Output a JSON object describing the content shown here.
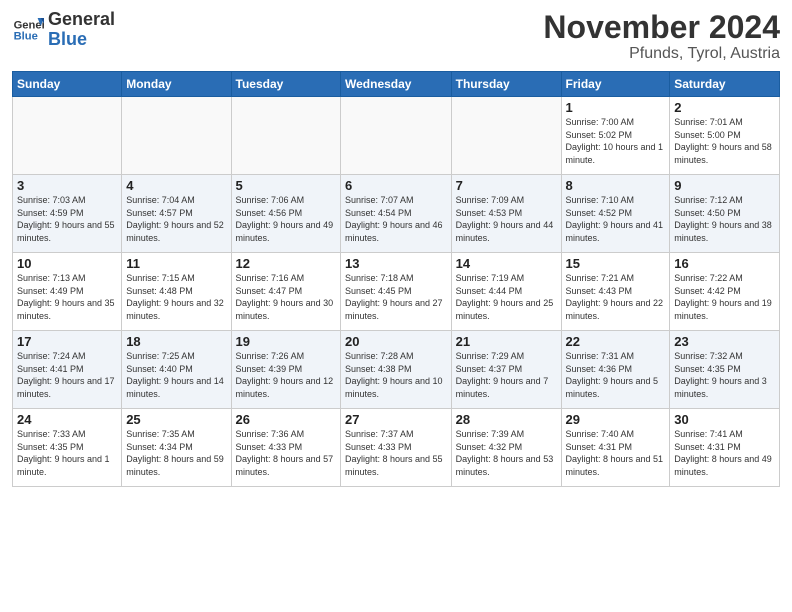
{
  "header": {
    "logo_line1": "General",
    "logo_line2": "Blue",
    "month": "November 2024",
    "location": "Pfunds, Tyrol, Austria"
  },
  "days_of_week": [
    "Sunday",
    "Monday",
    "Tuesday",
    "Wednesday",
    "Thursday",
    "Friday",
    "Saturday"
  ],
  "weeks": [
    [
      {
        "day": "",
        "info": ""
      },
      {
        "day": "",
        "info": ""
      },
      {
        "day": "",
        "info": ""
      },
      {
        "day": "",
        "info": ""
      },
      {
        "day": "",
        "info": ""
      },
      {
        "day": "1",
        "info": "Sunrise: 7:00 AM\nSunset: 5:02 PM\nDaylight: 10 hours and 1 minute."
      },
      {
        "day": "2",
        "info": "Sunrise: 7:01 AM\nSunset: 5:00 PM\nDaylight: 9 hours and 58 minutes."
      }
    ],
    [
      {
        "day": "3",
        "info": "Sunrise: 7:03 AM\nSunset: 4:59 PM\nDaylight: 9 hours and 55 minutes."
      },
      {
        "day": "4",
        "info": "Sunrise: 7:04 AM\nSunset: 4:57 PM\nDaylight: 9 hours and 52 minutes."
      },
      {
        "day": "5",
        "info": "Sunrise: 7:06 AM\nSunset: 4:56 PM\nDaylight: 9 hours and 49 minutes."
      },
      {
        "day": "6",
        "info": "Sunrise: 7:07 AM\nSunset: 4:54 PM\nDaylight: 9 hours and 46 minutes."
      },
      {
        "day": "7",
        "info": "Sunrise: 7:09 AM\nSunset: 4:53 PM\nDaylight: 9 hours and 44 minutes."
      },
      {
        "day": "8",
        "info": "Sunrise: 7:10 AM\nSunset: 4:52 PM\nDaylight: 9 hours and 41 minutes."
      },
      {
        "day": "9",
        "info": "Sunrise: 7:12 AM\nSunset: 4:50 PM\nDaylight: 9 hours and 38 minutes."
      }
    ],
    [
      {
        "day": "10",
        "info": "Sunrise: 7:13 AM\nSunset: 4:49 PM\nDaylight: 9 hours and 35 minutes."
      },
      {
        "day": "11",
        "info": "Sunrise: 7:15 AM\nSunset: 4:48 PM\nDaylight: 9 hours and 32 minutes."
      },
      {
        "day": "12",
        "info": "Sunrise: 7:16 AM\nSunset: 4:47 PM\nDaylight: 9 hours and 30 minutes."
      },
      {
        "day": "13",
        "info": "Sunrise: 7:18 AM\nSunset: 4:45 PM\nDaylight: 9 hours and 27 minutes."
      },
      {
        "day": "14",
        "info": "Sunrise: 7:19 AM\nSunset: 4:44 PM\nDaylight: 9 hours and 25 minutes."
      },
      {
        "day": "15",
        "info": "Sunrise: 7:21 AM\nSunset: 4:43 PM\nDaylight: 9 hours and 22 minutes."
      },
      {
        "day": "16",
        "info": "Sunrise: 7:22 AM\nSunset: 4:42 PM\nDaylight: 9 hours and 19 minutes."
      }
    ],
    [
      {
        "day": "17",
        "info": "Sunrise: 7:24 AM\nSunset: 4:41 PM\nDaylight: 9 hours and 17 minutes."
      },
      {
        "day": "18",
        "info": "Sunrise: 7:25 AM\nSunset: 4:40 PM\nDaylight: 9 hours and 14 minutes."
      },
      {
        "day": "19",
        "info": "Sunrise: 7:26 AM\nSunset: 4:39 PM\nDaylight: 9 hours and 12 minutes."
      },
      {
        "day": "20",
        "info": "Sunrise: 7:28 AM\nSunset: 4:38 PM\nDaylight: 9 hours and 10 minutes."
      },
      {
        "day": "21",
        "info": "Sunrise: 7:29 AM\nSunset: 4:37 PM\nDaylight: 9 hours and 7 minutes."
      },
      {
        "day": "22",
        "info": "Sunrise: 7:31 AM\nSunset: 4:36 PM\nDaylight: 9 hours and 5 minutes."
      },
      {
        "day": "23",
        "info": "Sunrise: 7:32 AM\nSunset: 4:35 PM\nDaylight: 9 hours and 3 minutes."
      }
    ],
    [
      {
        "day": "24",
        "info": "Sunrise: 7:33 AM\nSunset: 4:35 PM\nDaylight: 9 hours and 1 minute."
      },
      {
        "day": "25",
        "info": "Sunrise: 7:35 AM\nSunset: 4:34 PM\nDaylight: 8 hours and 59 minutes."
      },
      {
        "day": "26",
        "info": "Sunrise: 7:36 AM\nSunset: 4:33 PM\nDaylight: 8 hours and 57 minutes."
      },
      {
        "day": "27",
        "info": "Sunrise: 7:37 AM\nSunset: 4:33 PM\nDaylight: 8 hours and 55 minutes."
      },
      {
        "day": "28",
        "info": "Sunrise: 7:39 AM\nSunset: 4:32 PM\nDaylight: 8 hours and 53 minutes."
      },
      {
        "day": "29",
        "info": "Sunrise: 7:40 AM\nSunset: 4:31 PM\nDaylight: 8 hours and 51 minutes."
      },
      {
        "day": "30",
        "info": "Sunrise: 7:41 AM\nSunset: 4:31 PM\nDaylight: 8 hours and 49 minutes."
      }
    ]
  ]
}
